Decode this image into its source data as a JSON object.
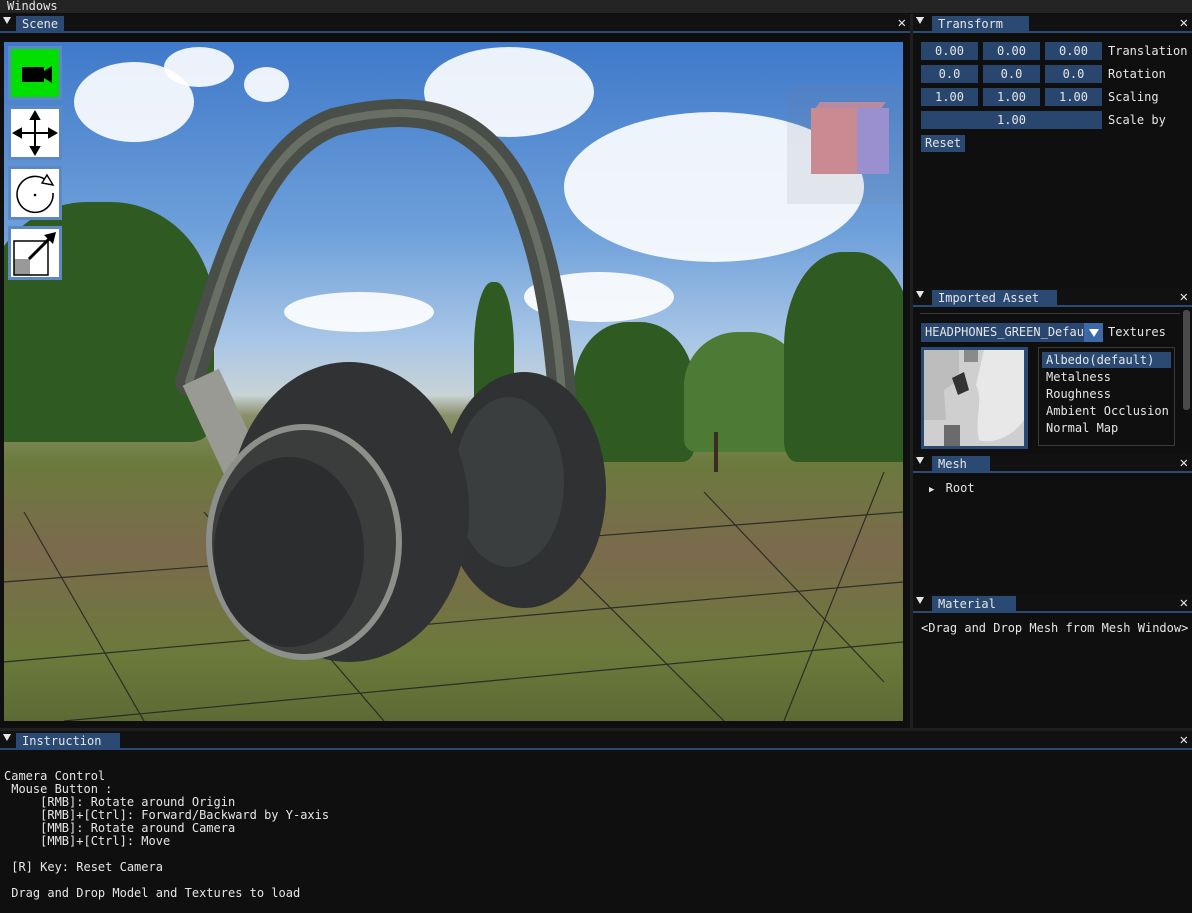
{
  "menubar": {
    "windows": "Windows"
  },
  "scene": {
    "tab": "Scene",
    "close": "✕"
  },
  "transform": {
    "tab": "Transform",
    "translation": [
      "0.00",
      "0.00",
      "0.00"
    ],
    "translation_label": "Translation",
    "rotation": [
      "0.0",
      "0.0",
      "0.0"
    ],
    "rotation_label": "Rotation",
    "scaling": [
      "1.00",
      "1.00",
      "1.00"
    ],
    "scaling_label": "Scaling",
    "scale_by": "1.00",
    "scale_by_label": "Scale by",
    "reset": "Reset"
  },
  "imported": {
    "tab": "Imported Asset",
    "asset": "HEADPHONES_GREEN_Default",
    "textures_label": "Textures",
    "textures": [
      "Albedo(default)",
      "Metalness",
      "Roughness",
      "Ambient Occlusion",
      "Normal Map"
    ]
  },
  "mesh": {
    "tab": "Mesh",
    "root": "Root"
  },
  "material": {
    "tab": "Material",
    "hint": "<Drag and Drop Mesh from Mesh Window>"
  },
  "instruction": {
    "tab": "Instruction",
    "lines": [
      "Camera Control",
      " Mouse Button :",
      "     [RMB]: Rotate around Origin",
      "     [RMB]+[Ctrl]: Forward/Backward by Y-axis",
      "     [MMB]: Rotate around Camera",
      "     [MMB]+[Ctrl]: Move",
      "",
      " [R] Key: Reset Camera",
      "",
      " Drag and Drop Model and Textures to load"
    ]
  },
  "colors": {
    "tab_active": "#2a4a73",
    "field": "#29466f",
    "tool_active": "#00e000"
  }
}
